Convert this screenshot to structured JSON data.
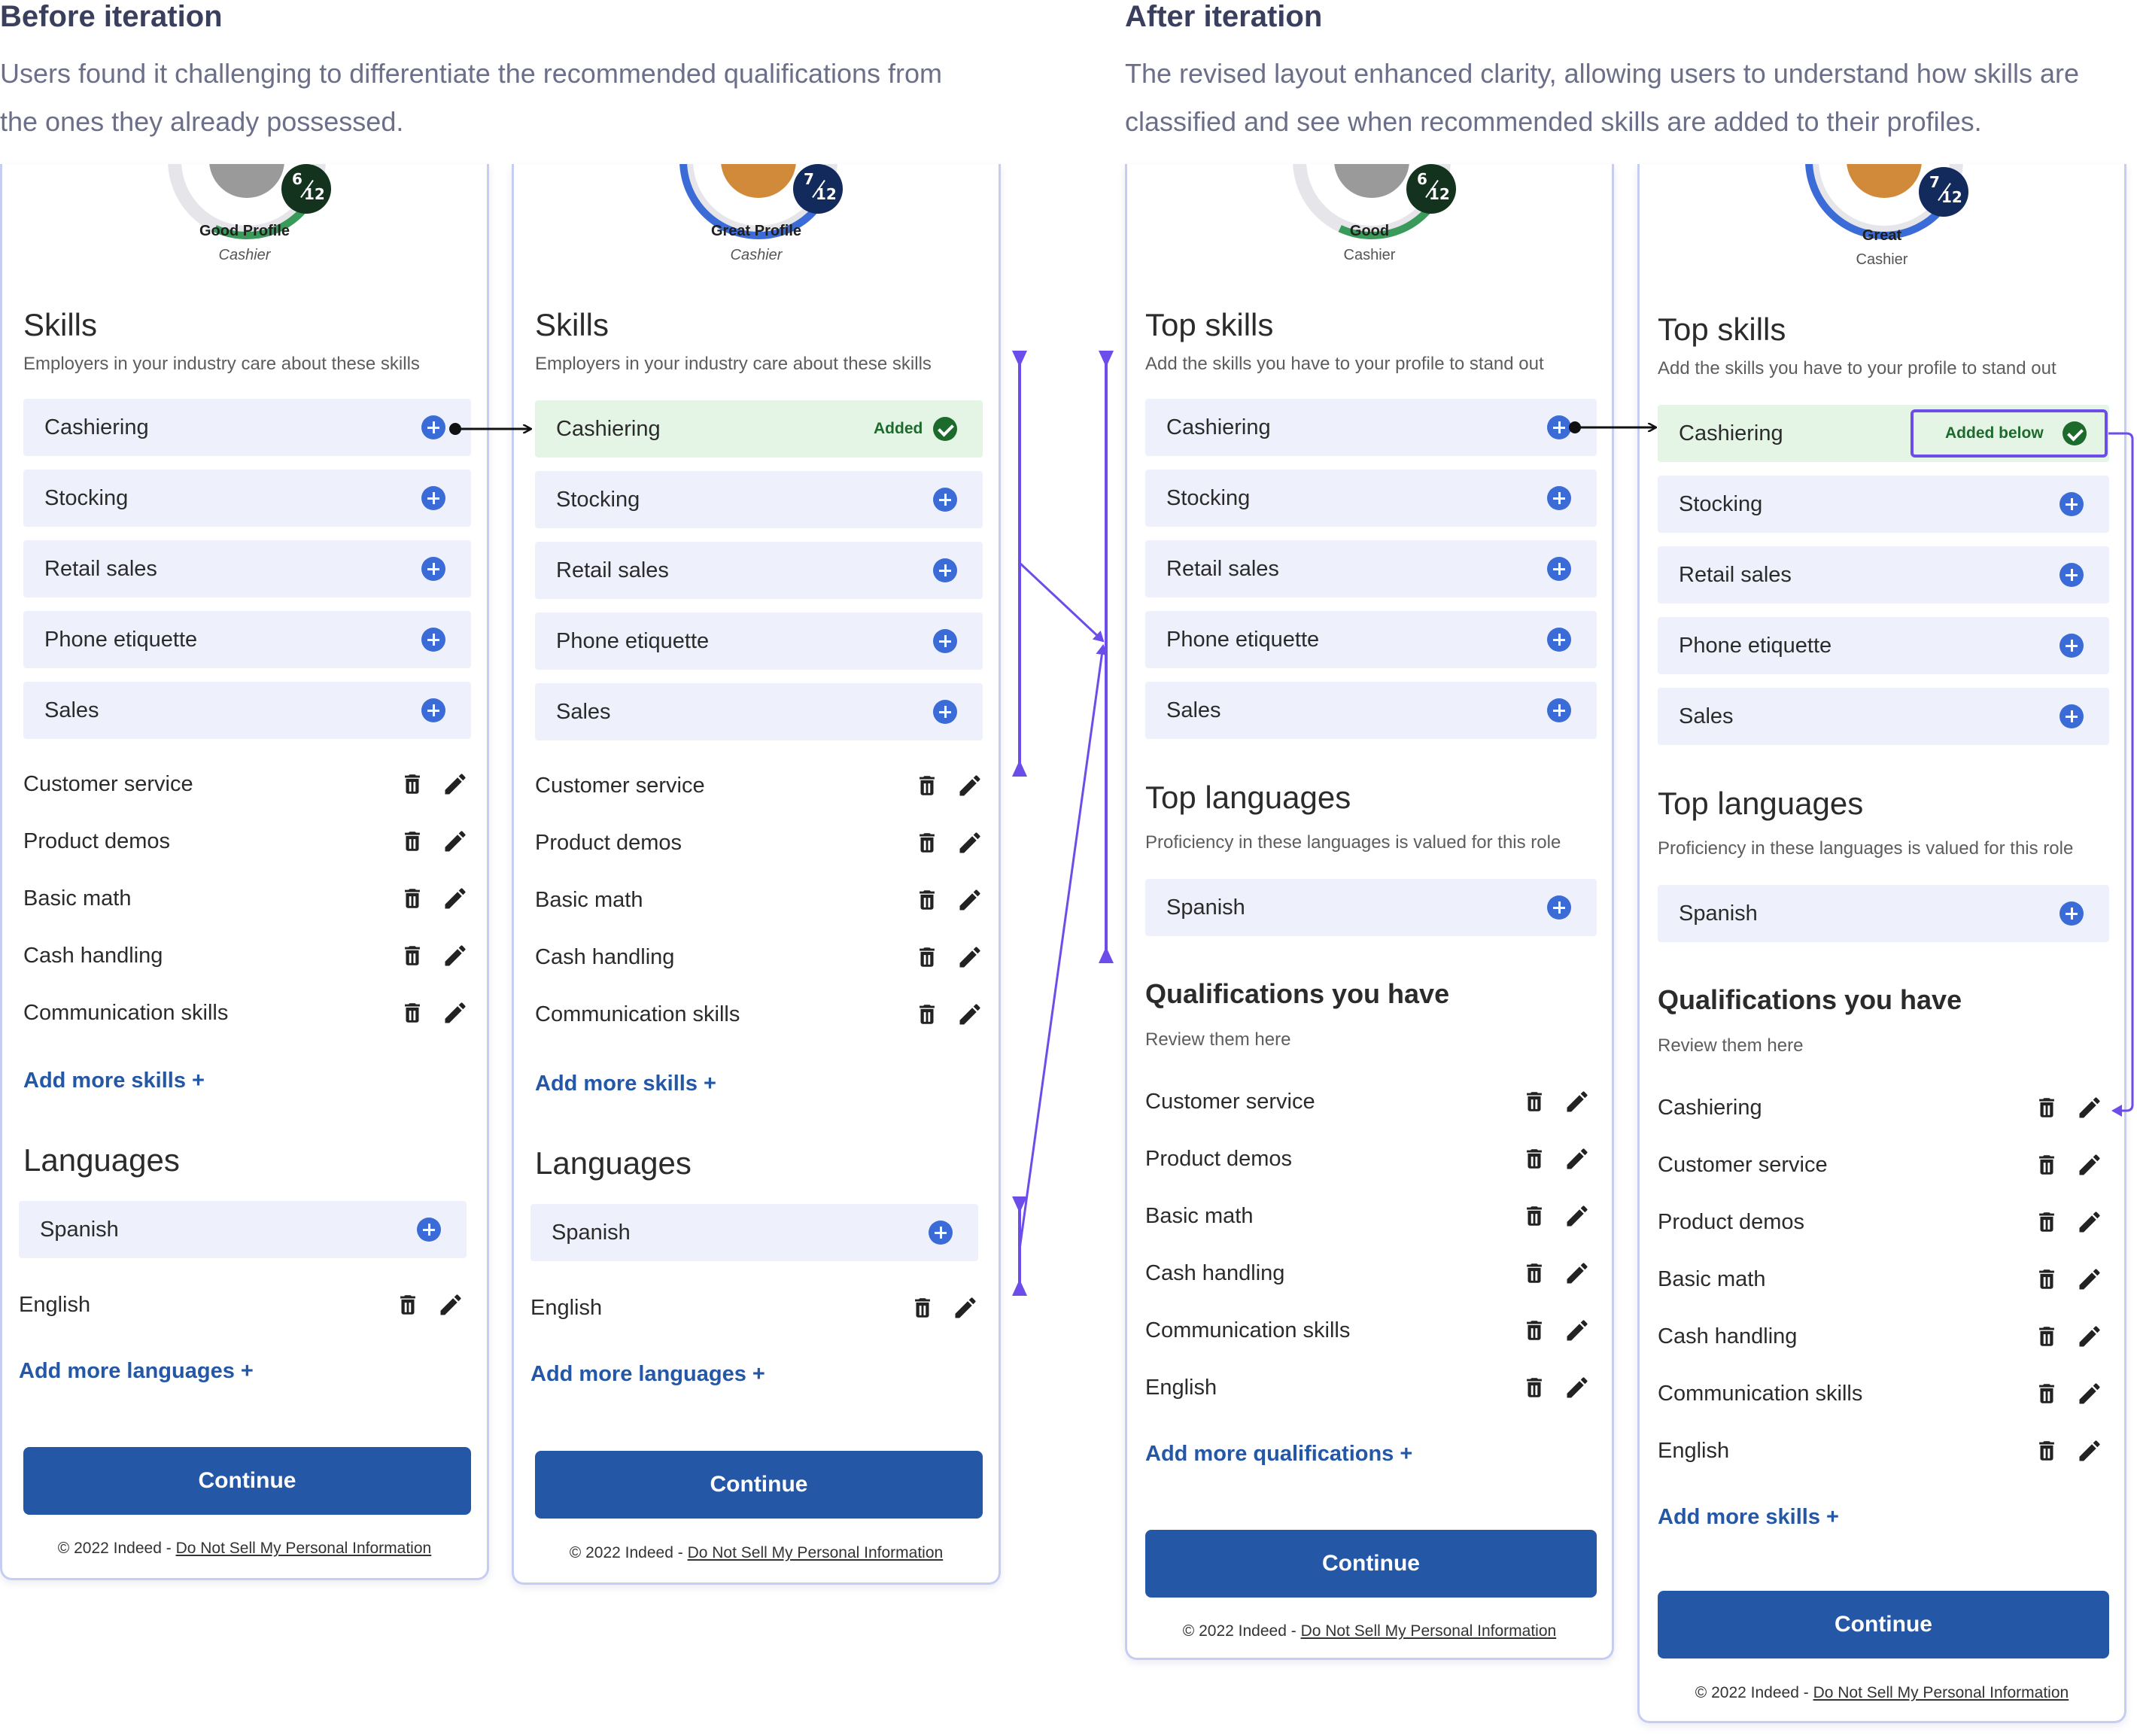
{
  "before": {
    "heading": "Before iteration",
    "desc_line1": "Users found it challenging to differentiate the recommended qualifications from",
    "desc_line2": "the ones they already possessed."
  },
  "after": {
    "heading": "After iteration",
    "desc_line1": "The revised layout enhanced clarity, allowing users to understand how skills are",
    "desc_line2": "classified and see when recommended skills are added to their profiles."
  },
  "colors": {
    "accent": "#6c4dea",
    "brand": "#2557a7",
    "added_bg": "#e5f5e5",
    "chip_bg": "#eef1fc",
    "plus": "#3b6bd6",
    "added_green": "#1d6b2c"
  },
  "panels": [
    {
      "profile": {
        "label": "Good Profile",
        "role": "Cashier",
        "score_num": "6",
        "score_den": "12",
        "ring_color": "#3a9a5a"
      },
      "skills_title": "Skills",
      "skills_sub": "Employers in your industry care about these skills",
      "suggested": [
        "Cashiering",
        "Stocking",
        "Retail sales",
        "Phone etiquette",
        "Sales"
      ],
      "have": [
        "Customer service",
        "Product demos",
        "Basic math",
        "Cash handling",
        "Communication skills"
      ],
      "add_skills": "Add more skills +",
      "lang_title": "Languages",
      "lang_suggested": [
        "Spanish"
      ],
      "lang_have": [
        "English"
      ],
      "add_lang": "Add more languages +",
      "continue": "Continue",
      "footer_prefix": "© 2022 Indeed - ",
      "footer_link": "Do Not Sell My Personal Information"
    },
    {
      "profile": {
        "label": "Great Profile",
        "role": "Cashier",
        "score_num": "7",
        "score_den": "12",
        "ring_color": "#3b6bd6"
      },
      "skills_title": "Skills",
      "skills_sub": "Employers in your industry care about these skills",
      "added_label": "Added",
      "suggested": [
        "Cashiering",
        "Stocking",
        "Retail sales",
        "Phone etiquette",
        "Sales"
      ],
      "have": [
        "Customer service",
        "Product demos",
        "Basic math",
        "Cash handling",
        "Communication skills"
      ],
      "add_skills": "Add more skills +",
      "lang_title": "Languages",
      "lang_suggested": [
        "Spanish"
      ],
      "lang_have": [
        "English"
      ],
      "add_lang": "Add more languages +",
      "continue": "Continue",
      "footer_prefix": "© 2022 Indeed - ",
      "footer_link": "Do Not Sell My Personal Information"
    },
    {
      "profile": {
        "label": "Good",
        "role": "Cashier",
        "score_num": "6",
        "score_den": "12",
        "ring_color": "#3a9a5a"
      },
      "skills_title": "Top skills",
      "skills_sub": "Add the skills you have to your profile to stand out",
      "suggested": [
        "Cashiering",
        "Stocking",
        "Retail sales",
        "Phone etiquette",
        "Sales"
      ],
      "lang_title": "Top languages",
      "lang_sub": "Proficiency in these languages is valued for this role",
      "lang_suggested": [
        "Spanish"
      ],
      "qual_title": "Qualifications you have",
      "qual_sub": "Review them here",
      "have": [
        "Customer service",
        "Product demos",
        "Basic math",
        "Cash handling",
        "Communication skills",
        "English"
      ],
      "add_qual": "Add more qualifications +",
      "continue": "Continue",
      "footer_prefix": "© 2022 Indeed - ",
      "footer_link": "Do Not Sell My Personal Information"
    },
    {
      "profile": {
        "label": "Great",
        "role": "Cashier",
        "score_num": "7",
        "score_den": "12",
        "ring_color": "#3b6bd6"
      },
      "skills_title": "Top skills",
      "skills_sub": "Add the skills you have to your profile to stand out",
      "added_label": "Added below",
      "suggested": [
        "Cashiering",
        "Stocking",
        "Retail sales",
        "Phone etiquette",
        "Sales"
      ],
      "lang_title": "Top languages",
      "lang_sub": "Proficiency in these languages is valued for this role",
      "lang_suggested": [
        "Spanish"
      ],
      "qual_title": "Qualifications you have",
      "qual_sub": "Review them here",
      "have": [
        "Cashiering",
        "Customer service",
        "Product demos",
        "Basic math",
        "Cash handling",
        "Communication skills",
        "English"
      ],
      "add_skills": "Add more skills +",
      "continue": "Continue",
      "footer_prefix": "© 2022 Indeed - ",
      "footer_link": "Do Not Sell My Personal Information"
    }
  ]
}
